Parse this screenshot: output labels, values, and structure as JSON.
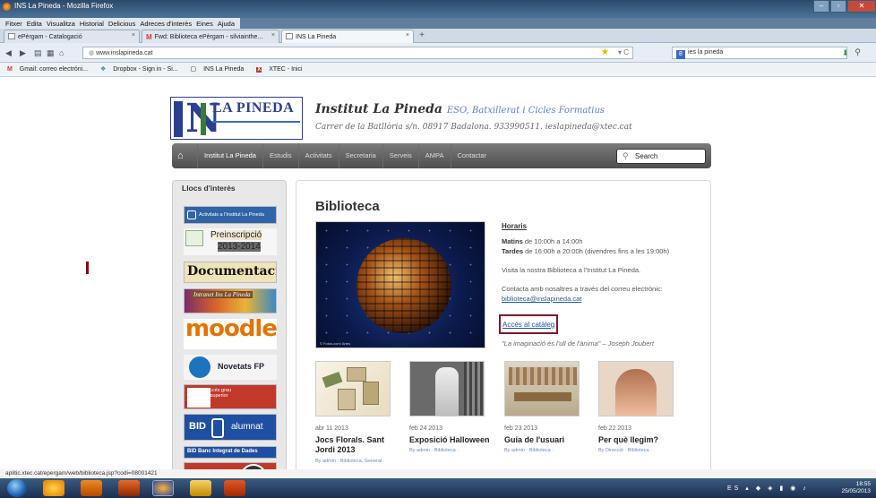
{
  "browser": {
    "window_title": "INS La Pineda - Mozilla Firefox",
    "menu": [
      "Fitxer",
      "Edita",
      "Visualitza",
      "Historial",
      "Delicious",
      "Adreces d'interès",
      "Eines",
      "Ajuda"
    ],
    "tabs": [
      {
        "label": "ePèrgam - Catalogació",
        "active": false
      },
      {
        "label": "Fwd: Biblioteca ePèrgam - silviainthe...",
        "active": false
      },
      {
        "label": "INS La Pineda",
        "active": true
      }
    ],
    "new_tab": "+",
    "url": "www.inslapineda.cat",
    "search_value": "ies la pineda",
    "bookmarks": [
      "Gmail: correo electróni...",
      "Dropbox - Sign in - Si...",
      "INS La Pineda",
      "XTEC - Inici"
    ],
    "status_url": "aplitic.xtec.cat/epergam/web/biblioteca.jsp?codi=08001421"
  },
  "site": {
    "logo_text": "LA PINEDA",
    "logo_letter": "N",
    "title": "Institut La Pineda",
    "subtitle": "ESO, Batxillerat i Cicles Formatius",
    "address": "Carrer de la Batllòria s/n. 08917 Badalona. 933990511. ieslapineda@xtec.cat",
    "nav": [
      "Institut La Pineda",
      "Estudis",
      "Activitats",
      "Secretaria",
      "Serveis",
      "AMPA",
      "Contactar"
    ],
    "search_placeholder": "Search"
  },
  "sidebar": {
    "heading": "Llocs d'interès",
    "banners": {
      "b1": "Activitats a l'Institut La Pineda",
      "b2_line1": "Preinscripció",
      "b2_line2": "2013-2014",
      "b3": "Documentació",
      "b4": "Intranet Ins La Pineda",
      "b5": "moodle",
      "b6": "Novetats FP",
      "b7": "proves d'accés grau mitjà grau superior",
      "b8_bid": "BID",
      "b8_alumnat": "alumnat",
      "b9": "BID Banc Integrat de Dades"
    }
  },
  "content": {
    "title": "Biblioteca",
    "hero_credit": "© Fotos.com/ Artes",
    "horaris_heading": "Horaris",
    "matins_label": "Matins",
    "matins_text": "de 10:00h a 14:00h",
    "tardes_label": "Tardes",
    "tardes_text": "de 16:00h a 20:00h (divendres fins a les 19:00h)",
    "visit_text": "Visita la nostra Biblioteca a l'Institut La Pineda.",
    "contact_text": "Contacta amb nosaltres a través del correu electrònic:",
    "email": "biblioteca@inslapineda.cat",
    "catalog_link": "Accés al catàleg",
    "quote": "\"La imaginació és l'ull de l'ànima\" – Joseph Joubert",
    "posts": [
      {
        "date": "abr 11 2013",
        "title": "Jocs Florals. Sant Jordi 2013",
        "meta": "By admin · Biblioteca, General ·"
      },
      {
        "date": "feb 24 2013",
        "title": "Exposició Halloween",
        "meta": "By admin · Biblioteca ·"
      },
      {
        "date": "feb 23 2013",
        "title": "Guia de l'usuari",
        "meta": "By admin · Biblioteca ·"
      },
      {
        "date": "feb 22 2013",
        "title": "Per què llegim?",
        "meta": "By Direcció · Biblioteca ·"
      }
    ]
  },
  "taskbar": {
    "language": "ES",
    "time": "18:55",
    "date": "25/05/2013"
  }
}
